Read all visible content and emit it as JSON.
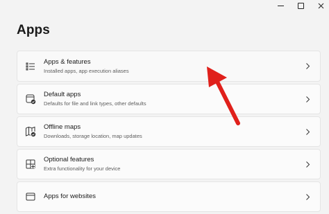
{
  "window": {
    "controls": [
      "minimize",
      "maximize",
      "close"
    ]
  },
  "page": {
    "title": "Apps"
  },
  "items": [
    {
      "label": "Apps & features",
      "description": "Installed apps, app execution aliases",
      "icon": "apps-features-icon"
    },
    {
      "label": "Default apps",
      "description": "Defaults for file and link types, other defaults",
      "icon": "default-apps-icon"
    },
    {
      "label": "Offline maps",
      "description": "Downloads, storage location, map updates",
      "icon": "offline-maps-icon"
    },
    {
      "label": "Optional features",
      "description": "Extra functionality for your device",
      "icon": "optional-features-icon"
    },
    {
      "label": "Apps for websites",
      "description": "",
      "icon": "apps-for-websites-icon"
    }
  ],
  "colors": {
    "background": "#f3f3f3",
    "card": "#fbfbfb",
    "annotation_arrow": "#e0201b"
  }
}
